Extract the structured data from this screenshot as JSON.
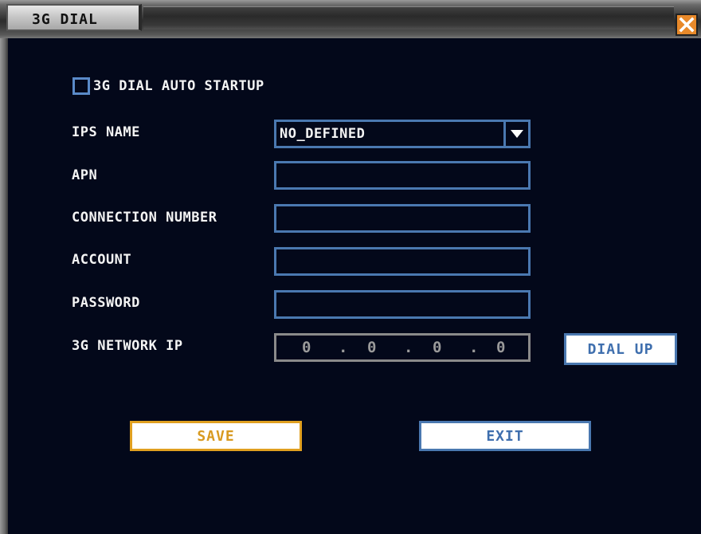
{
  "window": {
    "title": "3G DIAL"
  },
  "form": {
    "auto_startup": {
      "label": "3G DIAL AUTO STARTUP",
      "checked": false
    },
    "ips_name": {
      "label": "IPS NAME",
      "value": "NO_DEFINED"
    },
    "apn": {
      "label": "APN",
      "value": ""
    },
    "connection_number": {
      "label": "CONNECTION NUMBER",
      "value": ""
    },
    "account": {
      "label": "ACCOUNT",
      "value": ""
    },
    "password": {
      "label": "PASSWORD",
      "value": ""
    },
    "network_ip": {
      "label": "3G NETWORK IP",
      "octets": [
        "0",
        "0",
        "0",
        "0"
      ],
      "separator": "."
    }
  },
  "buttons": {
    "dial_up": "DIAL UP",
    "save": "SAVE",
    "exit": "EXIT"
  },
  "colors": {
    "background": "#03081a",
    "field_border": "#4a78b0",
    "save_accent": "#e0a020",
    "close_button": "#e8892a",
    "disabled_border": "#8a8a8a"
  },
  "icons": {
    "close": "close-x-icon",
    "dropdown": "dropdown-arrow-icon",
    "checkbox": "checkbox-icon"
  }
}
